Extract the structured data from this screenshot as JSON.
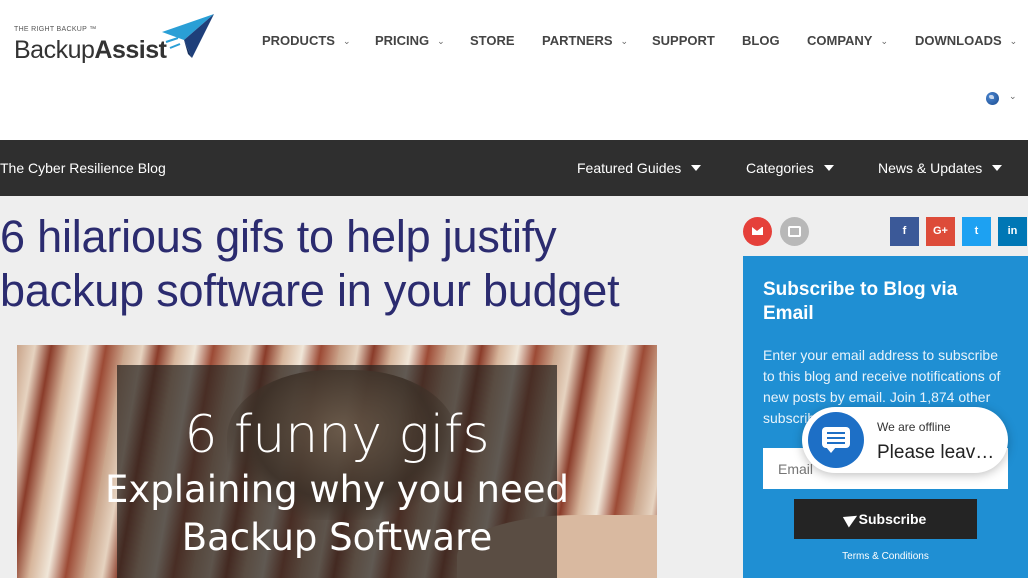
{
  "header": {
    "logo": {
      "tagline": "THE RIGHT BACKUP ™",
      "name_part1": "Backup",
      "name_part2": "Assist"
    },
    "nav": [
      {
        "label": "PRODUCTS",
        "has_dropdown": true
      },
      {
        "label": "PRICING",
        "has_dropdown": true
      },
      {
        "label": "STORE",
        "has_dropdown": false
      },
      {
        "label": "PARTNERS",
        "has_dropdown": true
      },
      {
        "label": "SUPPORT",
        "has_dropdown": false
      },
      {
        "label": "BLOG",
        "has_dropdown": false
      },
      {
        "label": "COMPANY",
        "has_dropdown": true
      },
      {
        "label": "DOWNLOADS",
        "has_dropdown": true
      }
    ],
    "language_icon": "globe-icon"
  },
  "blogbar": {
    "title": "The Cyber Resilience Blog",
    "menu": [
      "Featured Guides",
      "Categories",
      "News & Updates"
    ]
  },
  "article": {
    "title_line1": "6 hilarious gifs to help justify",
    "title_line2": "backup software in your budget",
    "hero": {
      "line1": "6 funny gifs",
      "line2": "Explaining why you need",
      "line3": "Backup Software"
    }
  },
  "share": {
    "email_icon": "envelope-icon",
    "print_icon": "printer-icon",
    "facebook": "f",
    "googleplus": "G+",
    "twitter": "t",
    "linkedin": "in"
  },
  "subscribe": {
    "title": "Subscribe to Blog via Email",
    "description": "Enter your email address to subscribe to this blog and receive notifications of new posts by email. Join 1,874 other subscribers.",
    "email_placeholder": "Email",
    "button_label": "Subscribe",
    "terms": "Terms & Conditions"
  },
  "chat": {
    "status": "We are offline",
    "message": "Please leave a message"
  },
  "colors": {
    "brand_navy": "#2b2b6f",
    "blogbar_bg": "#2f2f2f",
    "subscribe_bg": "#1f8fd3",
    "chat_blue": "#1d6fc6"
  }
}
